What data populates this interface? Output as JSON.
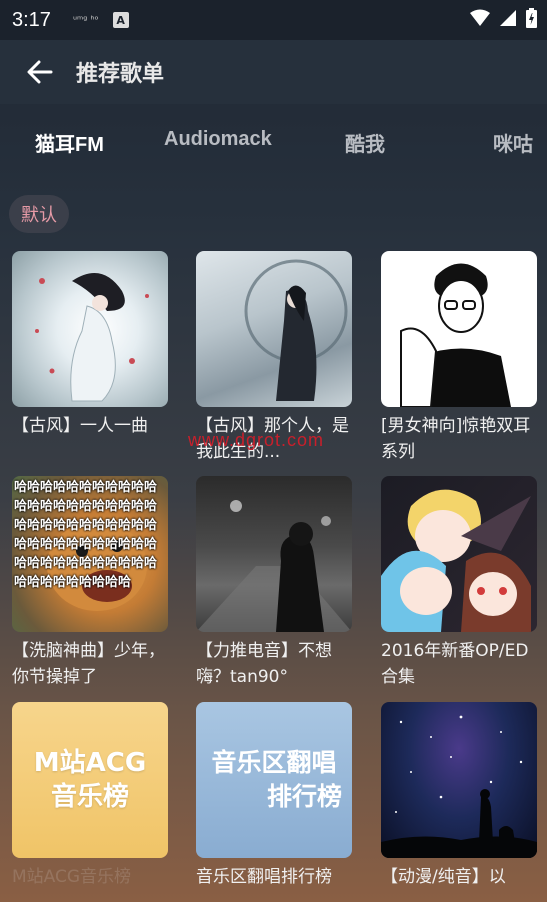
{
  "status": {
    "time": "3:17",
    "small": "ᵘᵐᵍ ʰᵒ"
  },
  "toolbar": {
    "title": "推荐歌单"
  },
  "tabs": [
    "猫耳FM",
    "Audiomack",
    "酷我",
    "咪咕"
  ],
  "chip": "默认",
  "cards": [
    {
      "caption": "【古风】一人一曲"
    },
    {
      "caption": "【古风】那个人，是我此生的..."
    },
    {
      "caption": "[男女神向]惊艳双耳系列"
    },
    {
      "caption": "【洗脑神曲】少年，你节操掉了"
    },
    {
      "caption": "【力推电音】不想嗨？tan90°"
    },
    {
      "caption": "2016年新番OP/ED合集"
    },
    {
      "caption": "M站ACG音乐榜"
    },
    {
      "caption": "音乐区翻唱排行榜"
    },
    {
      "caption": "【动漫/纯音】以"
    }
  ],
  "covers": {
    "m_line1": "M站ACG",
    "m_line2": "音乐榜",
    "y_line1": "音乐区翻唱",
    "y_line2": "排行榜",
    "haha": "哈哈哈哈哈哈哈哈哈哈哈哈哈哈哈哈哈哈哈哈哈哈哈哈哈哈哈哈哈哈哈哈哈哈哈哈哈哈哈哈哈哈哈哈哈哈哈哈哈哈哈哈哈哈哈哈哈哈哈哈哈哈哈哈"
  },
  "watermark": "www.dgrot.com",
  "colors": {
    "accent_chip": "#e59aa6",
    "toolbar": "#26303c"
  }
}
